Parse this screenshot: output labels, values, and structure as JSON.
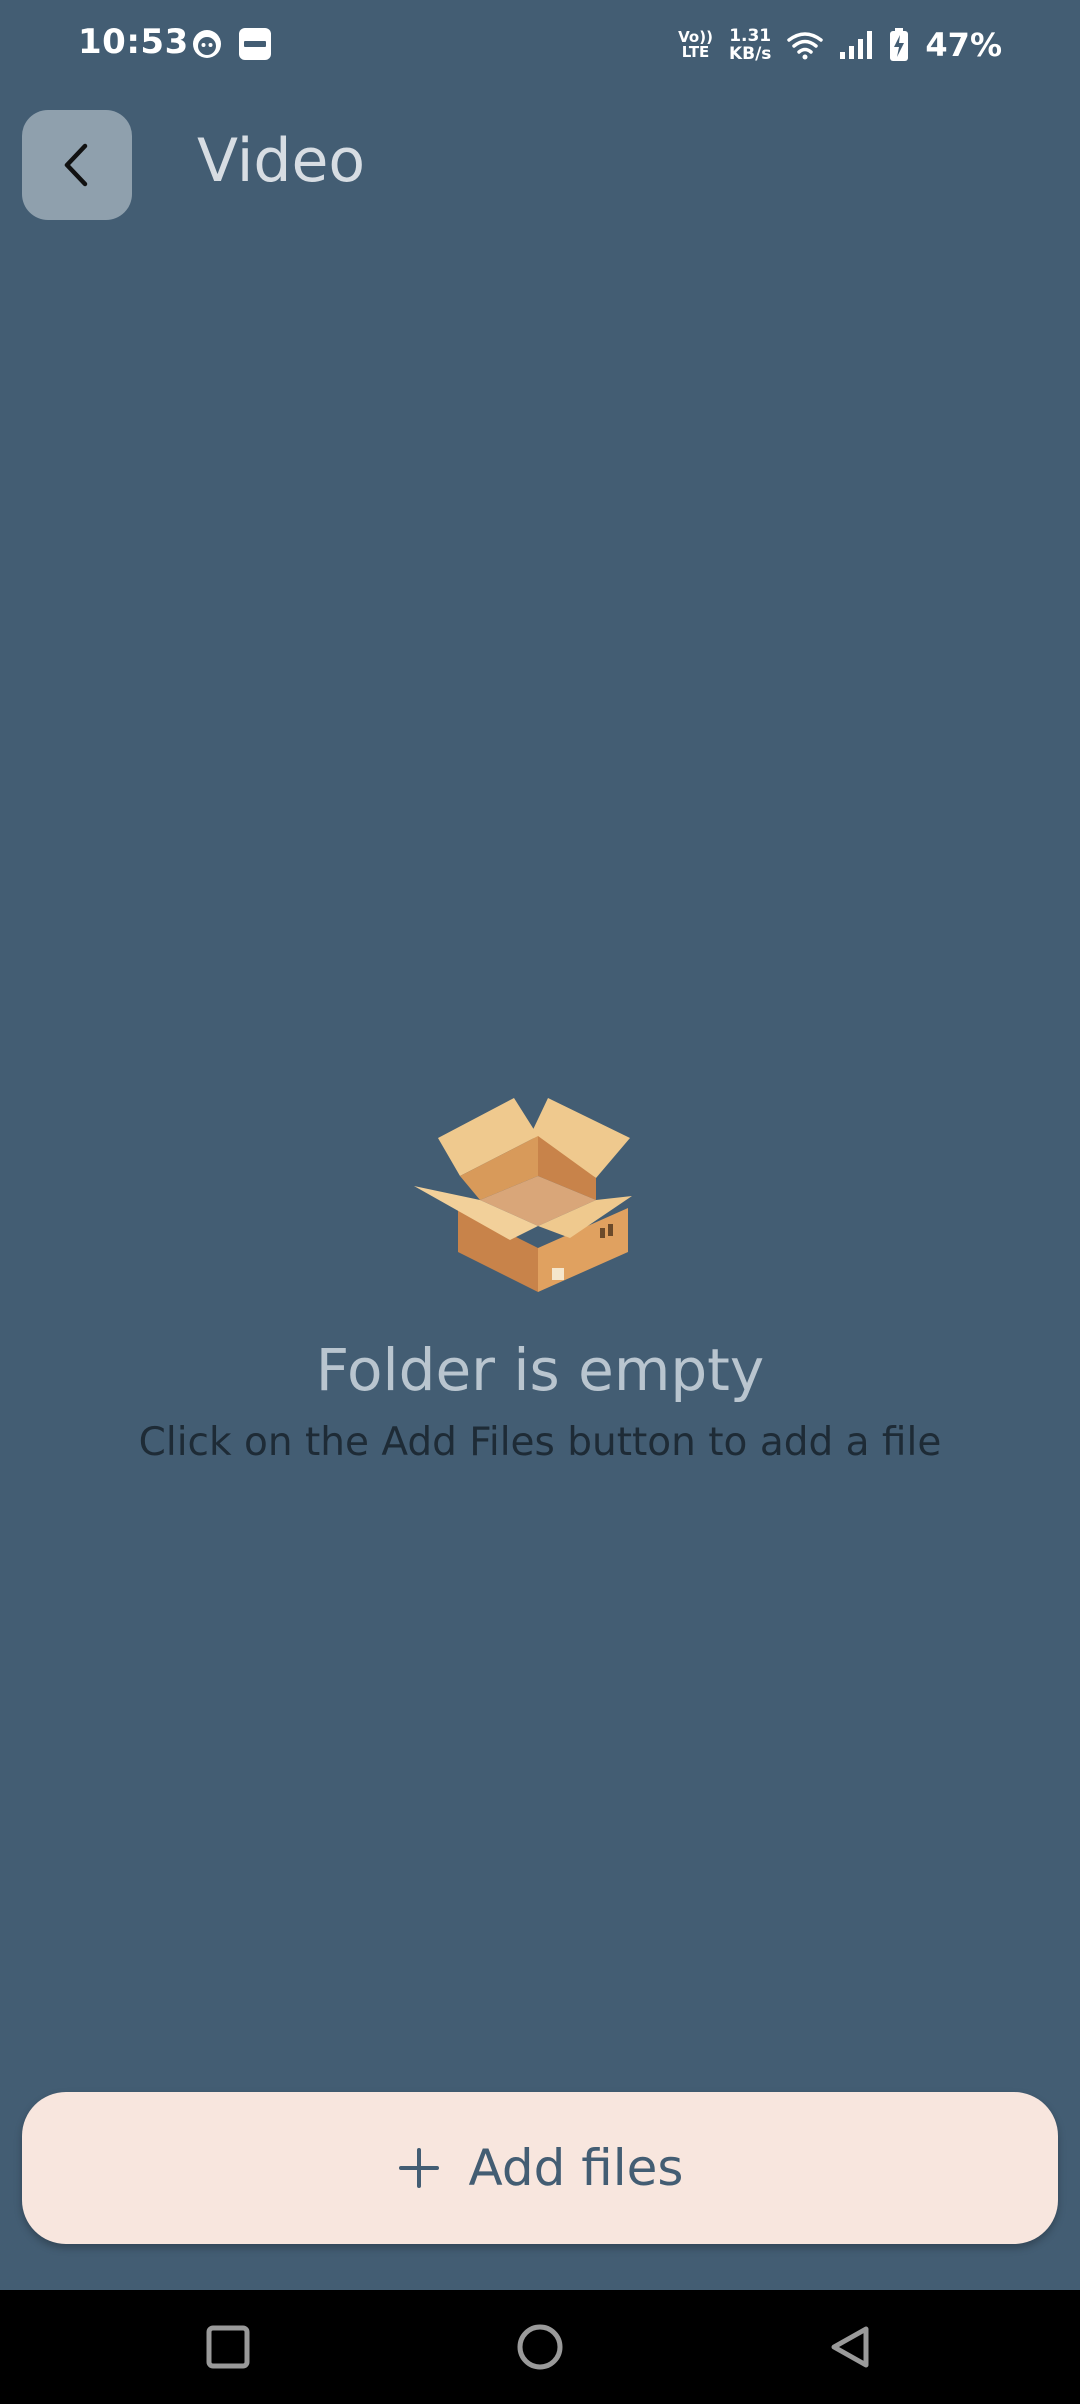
{
  "status_bar": {
    "time": "10:53",
    "volte_top": "Vo))",
    "volte_bottom": "LTE",
    "net_speed_value": "1.31",
    "net_speed_unit": "KB/s",
    "battery": "47%"
  },
  "header": {
    "title": "Video",
    "back_icon": "chevron-left-icon"
  },
  "empty_state": {
    "illustration": "open-box-icon",
    "title": "Folder is empty",
    "subtitle": "Click on the Add Files button to add a file"
  },
  "add_button": {
    "icon": "plus-icon",
    "label": "Add files"
  },
  "nav": {
    "recents_icon": "square-icon",
    "home_icon": "circle-icon",
    "back_icon": "triangle-back-icon"
  },
  "colors": {
    "background": "#435d73",
    "button_bg": "#f8e6de",
    "back_button_bg": "#8fa0ad"
  }
}
